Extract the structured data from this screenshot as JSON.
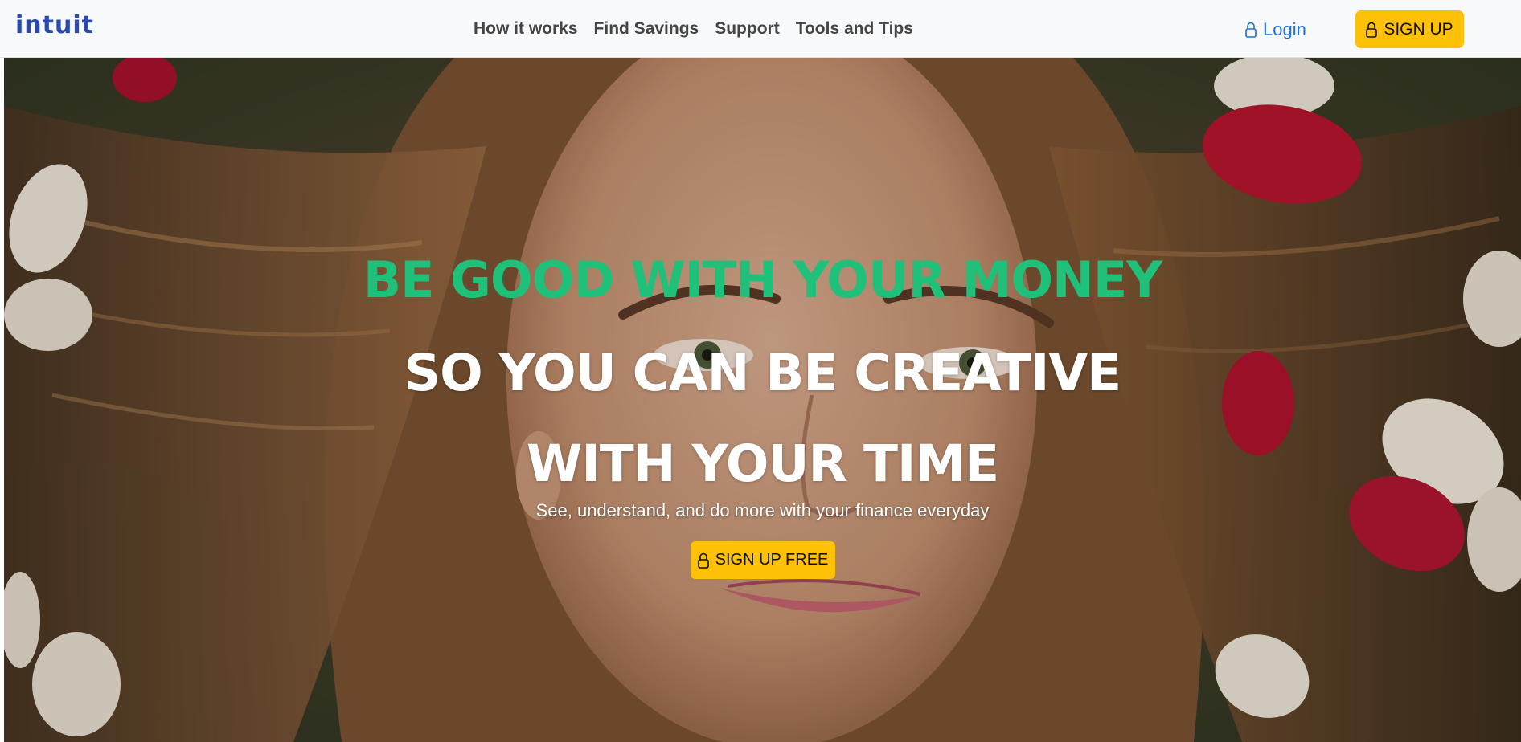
{
  "brand": {
    "logo_text": "intuit",
    "color": "#2a4bad"
  },
  "nav": {
    "links": [
      {
        "label": "How it works"
      },
      {
        "label": "Find Savings"
      },
      {
        "label": "Support"
      },
      {
        "label": "Tools and Tips"
      }
    ],
    "login_label": "Login",
    "login_icon": "lock-icon",
    "signup_label": "SIGN UP",
    "signup_icon": "lock-icon"
  },
  "hero": {
    "headline_line1": "BE GOOD WITH YOUR MONEY",
    "headline_line2": "SO YOU CAN BE CREATIVE",
    "headline_line3": "WITH YOUR TIME",
    "tagline": "See, understand, and do more with your finance everyday",
    "cta_label": "SIGN UP FREE",
    "cta_icon": "lock-icon",
    "background_image": "portrait-photo"
  },
  "colors": {
    "accent_green": "#1ec07a",
    "button_yellow": "#ffc107",
    "link_blue": "#1e6fd9",
    "navbar_bg": "#f8f9fa"
  }
}
